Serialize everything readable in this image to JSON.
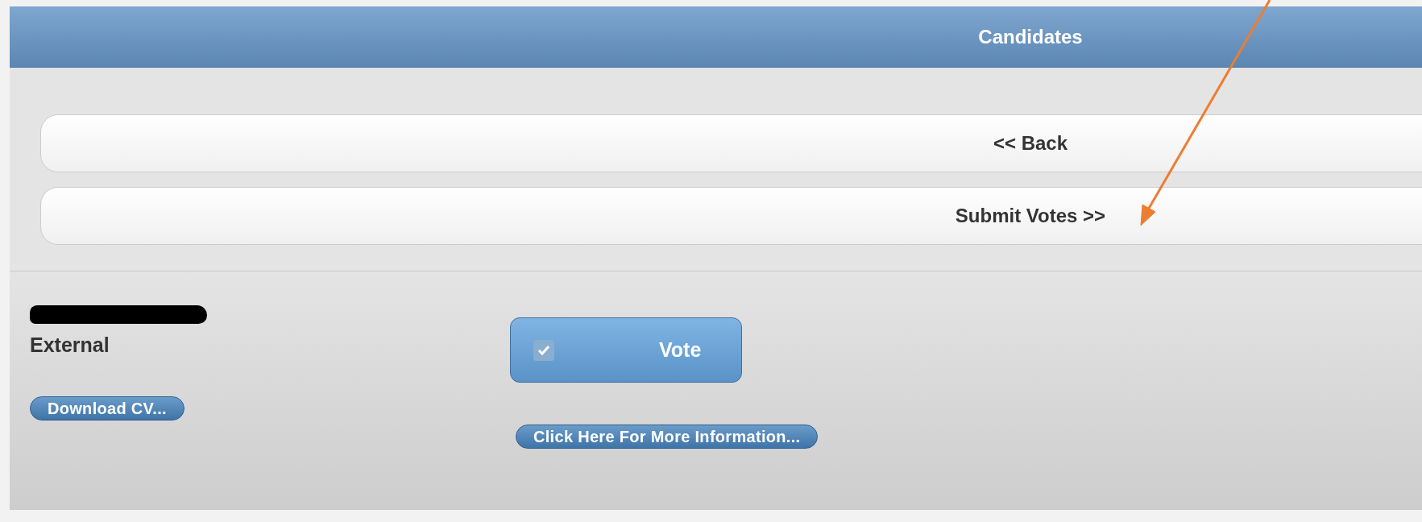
{
  "header": {
    "title": "Candidates"
  },
  "nav_buttons": [
    {
      "label": "<< Back"
    },
    {
      "label": "Submit Votes >>"
    }
  ],
  "candidate": {
    "type": "External",
    "download_button": "Download CV...",
    "vote": {
      "label": "Vote",
      "checked": true
    },
    "info_button": "Click Here For More Information..."
  }
}
